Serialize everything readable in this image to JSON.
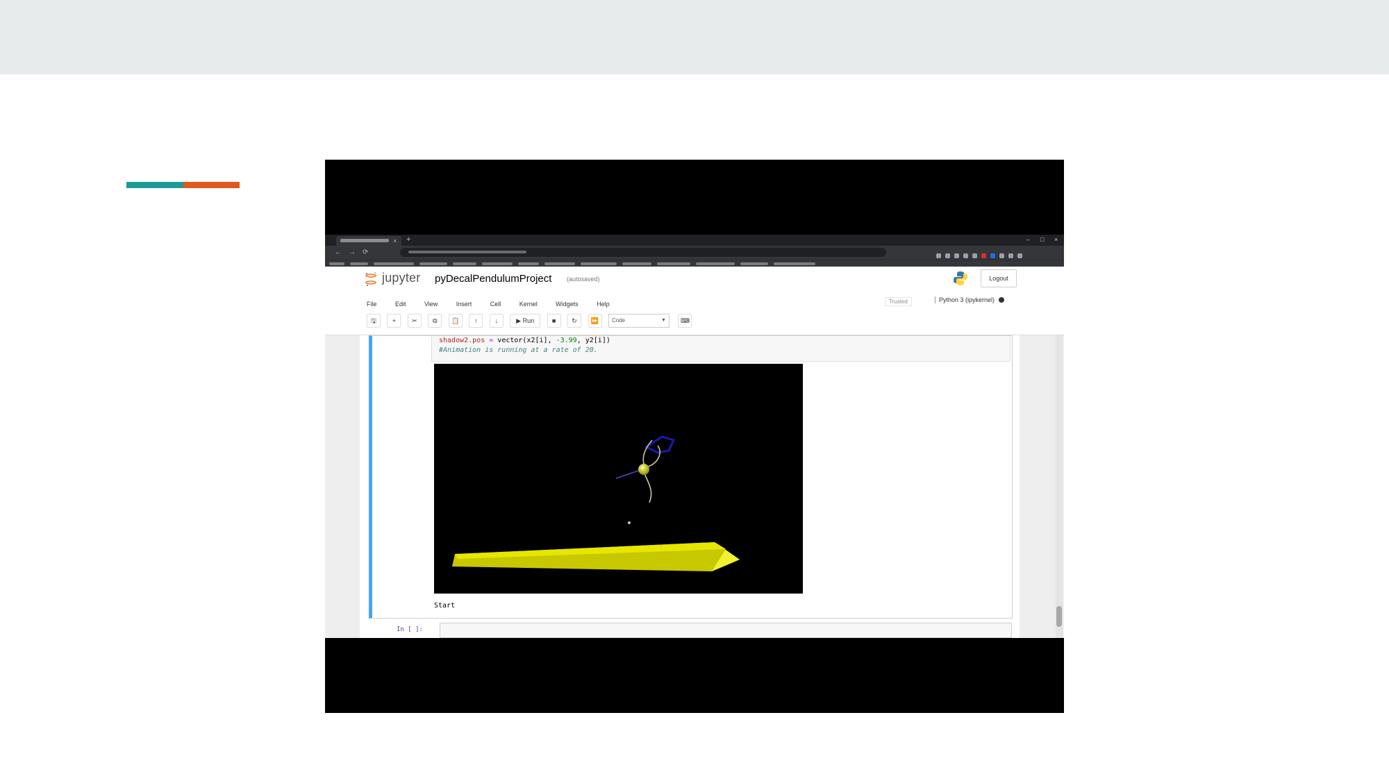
{
  "slide": {
    "accent_colors": [
      "#1d9a96",
      "#e2571e"
    ]
  },
  "browser": {
    "tab_close": "×",
    "new_tab": "+",
    "window_controls": [
      "–",
      "□",
      "×"
    ],
    "nav": [
      "←",
      "→",
      "⟳"
    ]
  },
  "jupyter": {
    "brand": "jupyter",
    "notebook_title": "pyDecalPendulumProject",
    "autosave_status": "(autosaved)",
    "logout_label": "Logout",
    "menu": [
      "File",
      "Edit",
      "View",
      "Insert",
      "Cell",
      "Kernel",
      "Widgets",
      "Help"
    ],
    "trusted_label": "Trusted",
    "kernel_name": "Python 3 (ipykernel)",
    "toolbar": {
      "save": "🖫",
      "add": "+",
      "cut": "✂",
      "copy": "⧉",
      "paste": "📋",
      "move_up": "↑",
      "move_down": "↓",
      "run": "▶ Run",
      "stop": "■",
      "restart": "↻",
      "fast_forward": "⏩",
      "cell_type": "Code",
      "keyboard": "⌨"
    }
  },
  "cell": {
    "code": {
      "var": "shadow2.pos",
      "eq": " = ",
      "call_start": "vector(x2[i], ",
      "num": "-3.99",
      "call_end": ", y2[i])",
      "comment": "#Animation is running at a rate of 20."
    },
    "output_text": "Start",
    "next_prompt": "In [ ]:"
  }
}
